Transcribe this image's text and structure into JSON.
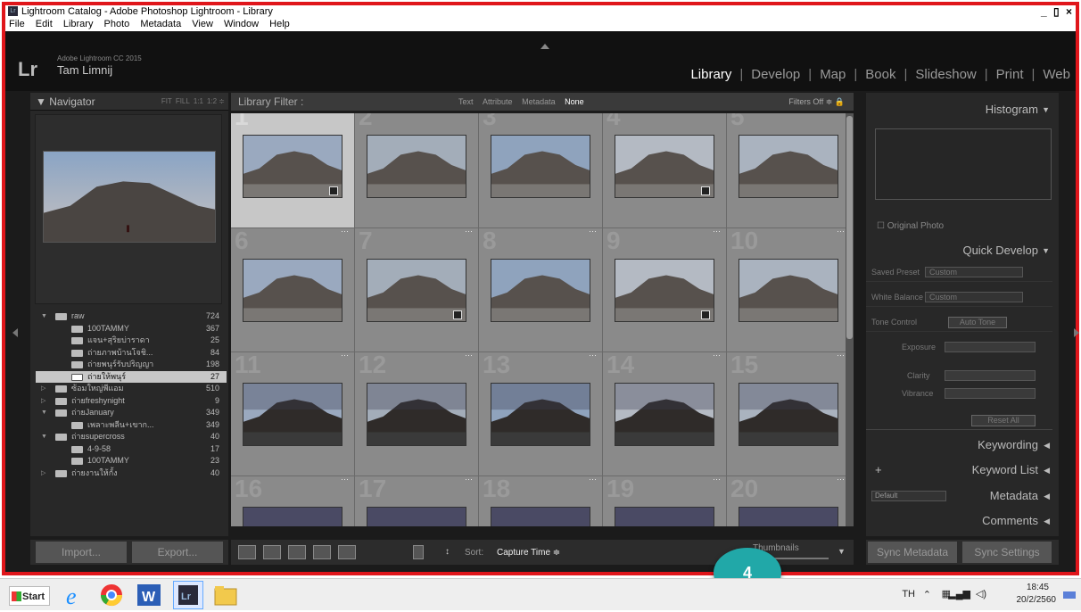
{
  "window": {
    "title": "Lightroom Catalog - Adobe Photoshop Lightroom - Library",
    "app_icon": "Lr",
    "controls": [
      "_",
      "▯",
      "×"
    ]
  },
  "menu": [
    "File",
    "Edit",
    "Library",
    "Photo",
    "Metadata",
    "View",
    "Window",
    "Help"
  ],
  "identity": {
    "logo": "Lr",
    "version": "Adobe Lightroom CC 2015",
    "name": "Tam Limnij"
  },
  "modules": [
    {
      "label": "Library",
      "active": true
    },
    {
      "label": "Develop"
    },
    {
      "label": "Map"
    },
    {
      "label": "Book"
    },
    {
      "label": "Slideshow"
    },
    {
      "label": "Print"
    },
    {
      "label": "Web"
    }
  ],
  "navigator": {
    "title": "Navigator",
    "zoom_options": [
      "FIT",
      "FILL",
      "1:1",
      "1:2 ≑"
    ]
  },
  "folders": [
    {
      "name": "raw",
      "count": "724",
      "level": 0,
      "expanded": true
    },
    {
      "name": "100TAMMY",
      "count": "367",
      "level": 1
    },
    {
      "name": "แจน+สุริยบ่าราดา",
      "count": "25",
      "level": 1
    },
    {
      "name": "ถ่ายภาพบ้านโจชิ...",
      "count": "84",
      "level": 1
    },
    {
      "name": "ถ่ายพนุร์รับปริญญา",
      "count": "198",
      "level": 1
    },
    {
      "name": "ถ่ายให้พนุร์",
      "count": "27",
      "level": 1,
      "selected": true
    },
    {
      "name": "ซ้อมใหญ่พีแอม",
      "count": "510",
      "level": 0
    },
    {
      "name": "ถ่ายfreshynight",
      "count": "9",
      "level": 0
    },
    {
      "name": "ถ่ายJanuary",
      "count": "349",
      "level": 0,
      "expanded": true
    },
    {
      "name": "เพลาะพลีน+เขาก...",
      "count": "349",
      "level": 1
    },
    {
      "name": "ถ่ายsupercross",
      "count": "40",
      "level": 0,
      "expanded": true
    },
    {
      "name": "4-9-58",
      "count": "17",
      "level": 1
    },
    {
      "name": "100TAMMY",
      "count": "23",
      "level": 1
    },
    {
      "name": "ถ่ายงานให้กั้ง",
      "count": "40",
      "level": 0
    }
  ],
  "left_buttons": {
    "import": "Import...",
    "export": "Export..."
  },
  "filter_bar": {
    "label": "Library Filter :",
    "options": [
      "Text",
      "Attribute",
      "Metadata",
      "None"
    ],
    "active": "None",
    "filters_off": "Filters Off ≑"
  },
  "grid": {
    "cells": [
      "1",
      "2",
      "3",
      "4",
      "5",
      "6",
      "7",
      "8",
      "9",
      "10",
      "11",
      "12",
      "13",
      "14",
      "15",
      "16",
      "17",
      "18",
      "19",
      "20"
    ],
    "selected": "1",
    "dots": "···"
  },
  "toolbar": {
    "sort_label": "Sort:",
    "sort_value": "Capture Time ≑",
    "thumbnails_label": "Thumbnails"
  },
  "right_panel": {
    "histogram": "Histogram",
    "original_photo": "Original Photo",
    "quick_develop": "Quick Develop",
    "saved_preset_label": "Saved Preset",
    "saved_preset_value": "Custom",
    "white_balance_label": "White Balance",
    "white_balance_value": "Custom",
    "tone_control_label": "Tone Control",
    "auto_tone": "Auto Tone",
    "exposure": "Exposure",
    "clarity": "Clarity",
    "vibrance": "Vibrance",
    "reset_all": "Reset All",
    "keywording": "Keywording",
    "keyword_list": "Keyword List",
    "metadata": "Metadata",
    "metadata_preset": "Default",
    "comments": "Comments",
    "sync_metadata": "Sync Metadata",
    "sync_settings": "Sync Settings"
  },
  "callout": {
    "number": "4",
    "color": "#21a8a8"
  },
  "taskbar": {
    "start": "Start",
    "lang": "TH",
    "time": "18:45",
    "date": "20/2/2560"
  },
  "colors": {
    "frame": "#e0161b",
    "selected_cell": "#c7c7c7",
    "active_module": "#ffffff"
  }
}
